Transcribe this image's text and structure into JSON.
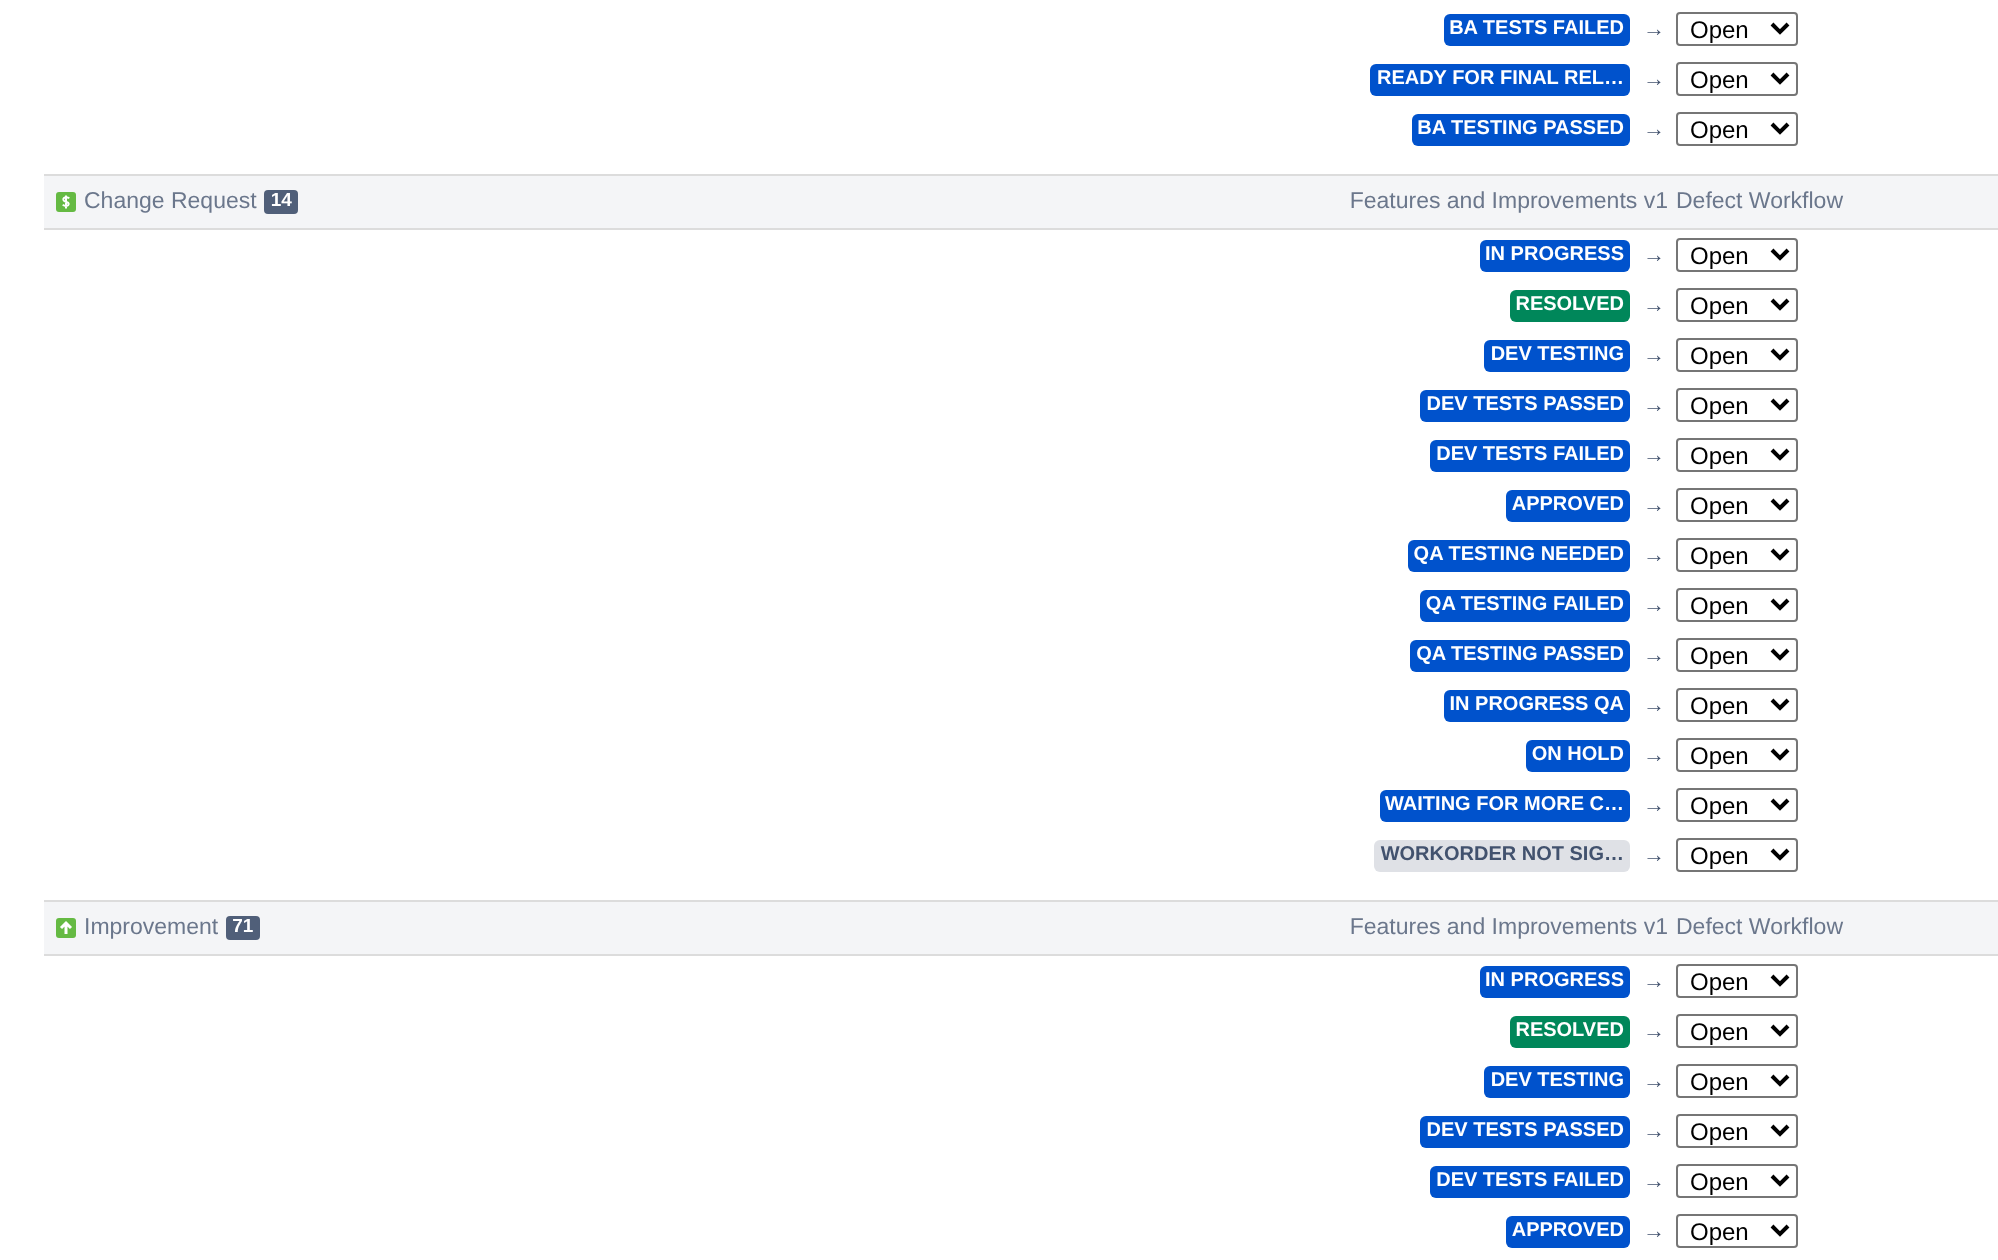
{
  "sections": [
    {
      "rows": [
        {
          "status": "BA TESTS FAILED",
          "color": "#0052cc",
          "arrow": "→",
          "target": "Open"
        },
        {
          "status": "READY FOR FINAL REL…",
          "color": "#0052cc",
          "arrow": "→",
          "target": "Open"
        },
        {
          "status": "BA TESTING PASSED",
          "color": "#0052cc",
          "arrow": "→",
          "target": "Open"
        }
      ]
    },
    {
      "kind": "dollar",
      "title": "Change Request",
      "count": "14",
      "source_workflow": "Features and Improvements v1",
      "target_workflow": "Defect Workflow",
      "rows": [
        {
          "status": "IN PROGRESS",
          "color": "#0052cc",
          "arrow": "→",
          "target": "Open"
        },
        {
          "status": "RESOLVED",
          "color": "#00875a",
          "arrow": "→",
          "target": "Open"
        },
        {
          "status": "DEV TESTING",
          "color": "#0052cc",
          "arrow": "→",
          "target": "Open"
        },
        {
          "status": "DEV TESTS PASSED",
          "color": "#0052cc",
          "arrow": "→",
          "target": "Open"
        },
        {
          "status": "DEV TESTS FAILED",
          "color": "#0052cc",
          "arrow": "→",
          "target": "Open"
        },
        {
          "status": "APPROVED",
          "color": "#0052cc",
          "arrow": "→",
          "target": "Open"
        },
        {
          "status": "QA TESTING NEEDED",
          "color": "#0052cc",
          "arrow": "→",
          "target": "Open"
        },
        {
          "status": "QA TESTING FAILED",
          "color": "#0052cc",
          "arrow": "→",
          "target": "Open"
        },
        {
          "status": "QA TESTING PASSED",
          "color": "#0052cc",
          "arrow": "→",
          "target": "Open"
        },
        {
          "status": "IN PROGRESS QA",
          "color": "#0052cc",
          "arrow": "→",
          "target": "Open"
        },
        {
          "status": "ON HOLD",
          "color": "#0052cc",
          "arrow": "→",
          "target": "Open"
        },
        {
          "status": "WAITING FOR MORE C…",
          "color": "#0052cc",
          "arrow": "→",
          "target": "Open"
        },
        {
          "status": "WORKORDER NOT SIG…",
          "color": "#dfe1e6",
          "arrow": "→",
          "target": "Open"
        }
      ]
    },
    {
      "kind": "arrow",
      "title": "Improvement",
      "count": "71",
      "source_workflow": "Features and Improvements v1",
      "target_workflow": "Defect Workflow",
      "rows": [
        {
          "status": "IN PROGRESS",
          "color": "#0052cc",
          "arrow": "→",
          "target": "Open"
        },
        {
          "status": "RESOLVED",
          "color": "#00875a",
          "arrow": "→",
          "target": "Open"
        },
        {
          "status": "DEV TESTING",
          "color": "#0052cc",
          "arrow": "→",
          "target": "Open"
        },
        {
          "status": "DEV TESTS PASSED",
          "color": "#0052cc",
          "arrow": "→",
          "target": "Open"
        },
        {
          "status": "DEV TESTS FAILED",
          "color": "#0052cc",
          "arrow": "→",
          "target": "Open"
        },
        {
          "status": "APPROVED",
          "color": "#0052cc",
          "arrow": "→",
          "target": "Open"
        }
      ]
    }
  ]
}
